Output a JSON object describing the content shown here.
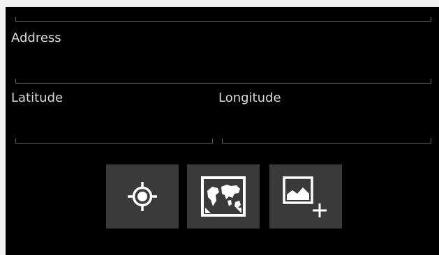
{
  "form": {
    "address_label": "Address",
    "latitude_label": "Latitude",
    "longitude_label": "Longitude",
    "address_value": "",
    "latitude_value": "",
    "longitude_value": ""
  },
  "actions": [
    {
      "name": "current-location",
      "icon": "crosshair-location-icon"
    },
    {
      "name": "map",
      "icon": "world-map-icon"
    },
    {
      "name": "add-image",
      "icon": "add-image-icon"
    }
  ],
  "colors": {
    "background": "#000000",
    "text": "#d9d9d9",
    "field_line": "#5f5f5f",
    "button": "#3a3a3a",
    "icon": "#ffffff"
  }
}
